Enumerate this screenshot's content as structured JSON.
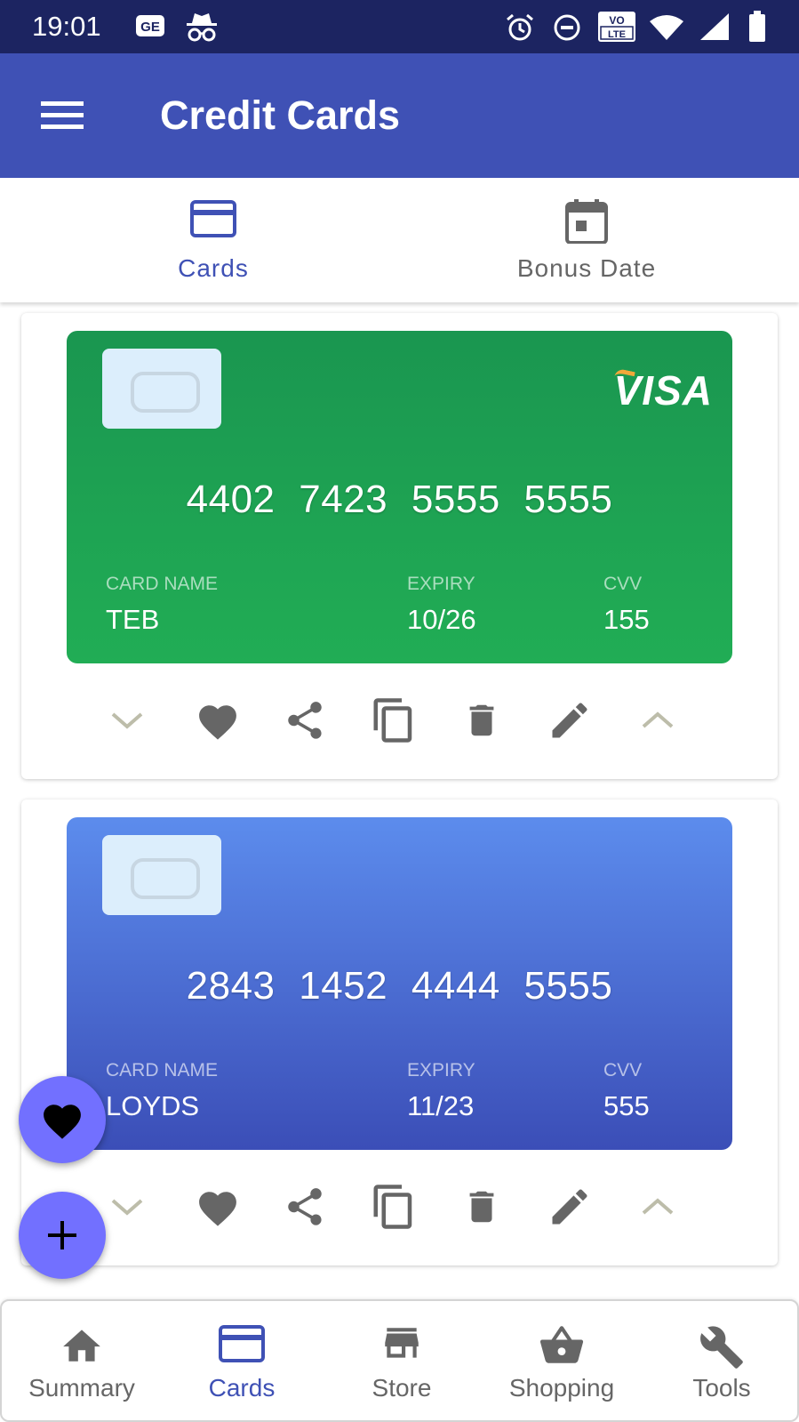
{
  "status_bar": {
    "time": "19:01"
  },
  "app_bar": {
    "title": "Credit Cards"
  },
  "tabs": [
    {
      "label": "Cards",
      "icon": "credit-card-icon",
      "active": true
    },
    {
      "label": "Bonus Date",
      "icon": "calendar-icon",
      "active": false
    }
  ],
  "cards": [
    {
      "number": "4402  7423  5555  5555",
      "brand": "VISA",
      "name_label": "CARD NAME",
      "name": "TEB",
      "expiry_label": "EXPIRY",
      "expiry": "10/26",
      "cvv_label": "CVV",
      "cvv": "155",
      "color": "#1f9e51"
    },
    {
      "number": "2843  1452  4444  5555",
      "brand": "",
      "name_label": "CARD NAME",
      "name": "LOYDS",
      "expiry_label": "EXPIRY",
      "expiry": "11/23",
      "cvv_label": "CVV",
      "cvv": "555",
      "color": "#4a6ad6"
    }
  ],
  "card_actions": [
    "chevron-down-icon",
    "heart-icon",
    "share-icon",
    "copy-icon",
    "delete-icon",
    "edit-icon",
    "chevron-up-icon"
  ],
  "fabs": [
    "favorite-fab",
    "add-fab"
  ],
  "bottom_nav": [
    {
      "label": "Summary",
      "icon": "home-icon",
      "active": false
    },
    {
      "label": "Cards",
      "icon": "credit-card-icon",
      "active": true
    },
    {
      "label": "Store",
      "icon": "store-icon",
      "active": false
    },
    {
      "label": "Shopping",
      "icon": "basket-icon",
      "active": false
    },
    {
      "label": "Tools",
      "icon": "wrench-icon",
      "active": false
    }
  ],
  "colors": {
    "primary": "#3f51b5",
    "status_bar": "#1c2461",
    "fab": "#7270ff",
    "icon_gray": "#666666",
    "chevron": "#bdbdaa"
  }
}
